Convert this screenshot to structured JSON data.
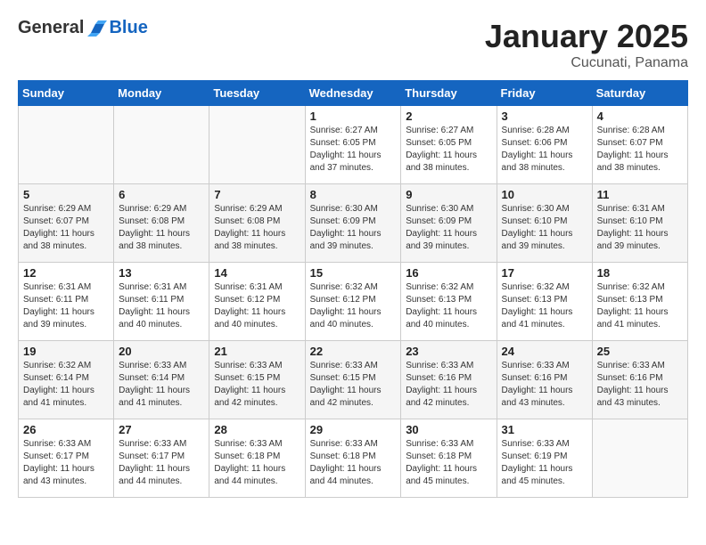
{
  "logo": {
    "general": "General",
    "blue": "Blue"
  },
  "title": "January 2025",
  "subtitle": "Cucunati, Panama",
  "days_of_week": [
    "Sunday",
    "Monday",
    "Tuesday",
    "Wednesday",
    "Thursday",
    "Friday",
    "Saturday"
  ],
  "weeks": [
    [
      {
        "day": "",
        "info": ""
      },
      {
        "day": "",
        "info": ""
      },
      {
        "day": "",
        "info": ""
      },
      {
        "day": "1",
        "info": "Sunrise: 6:27 AM\nSunset: 6:05 PM\nDaylight: 11 hours\nand 37 minutes."
      },
      {
        "day": "2",
        "info": "Sunrise: 6:27 AM\nSunset: 6:05 PM\nDaylight: 11 hours\nand 38 minutes."
      },
      {
        "day": "3",
        "info": "Sunrise: 6:28 AM\nSunset: 6:06 PM\nDaylight: 11 hours\nand 38 minutes."
      },
      {
        "day": "4",
        "info": "Sunrise: 6:28 AM\nSunset: 6:07 PM\nDaylight: 11 hours\nand 38 minutes."
      }
    ],
    [
      {
        "day": "5",
        "info": "Sunrise: 6:29 AM\nSunset: 6:07 PM\nDaylight: 11 hours\nand 38 minutes."
      },
      {
        "day": "6",
        "info": "Sunrise: 6:29 AM\nSunset: 6:08 PM\nDaylight: 11 hours\nand 38 minutes."
      },
      {
        "day": "7",
        "info": "Sunrise: 6:29 AM\nSunset: 6:08 PM\nDaylight: 11 hours\nand 38 minutes."
      },
      {
        "day": "8",
        "info": "Sunrise: 6:30 AM\nSunset: 6:09 PM\nDaylight: 11 hours\nand 39 minutes."
      },
      {
        "day": "9",
        "info": "Sunrise: 6:30 AM\nSunset: 6:09 PM\nDaylight: 11 hours\nand 39 minutes."
      },
      {
        "day": "10",
        "info": "Sunrise: 6:30 AM\nSunset: 6:10 PM\nDaylight: 11 hours\nand 39 minutes."
      },
      {
        "day": "11",
        "info": "Sunrise: 6:31 AM\nSunset: 6:10 PM\nDaylight: 11 hours\nand 39 minutes."
      }
    ],
    [
      {
        "day": "12",
        "info": "Sunrise: 6:31 AM\nSunset: 6:11 PM\nDaylight: 11 hours\nand 39 minutes."
      },
      {
        "day": "13",
        "info": "Sunrise: 6:31 AM\nSunset: 6:11 PM\nDaylight: 11 hours\nand 40 minutes."
      },
      {
        "day": "14",
        "info": "Sunrise: 6:31 AM\nSunset: 6:12 PM\nDaylight: 11 hours\nand 40 minutes."
      },
      {
        "day": "15",
        "info": "Sunrise: 6:32 AM\nSunset: 6:12 PM\nDaylight: 11 hours\nand 40 minutes."
      },
      {
        "day": "16",
        "info": "Sunrise: 6:32 AM\nSunset: 6:13 PM\nDaylight: 11 hours\nand 40 minutes."
      },
      {
        "day": "17",
        "info": "Sunrise: 6:32 AM\nSunset: 6:13 PM\nDaylight: 11 hours\nand 41 minutes."
      },
      {
        "day": "18",
        "info": "Sunrise: 6:32 AM\nSunset: 6:13 PM\nDaylight: 11 hours\nand 41 minutes."
      }
    ],
    [
      {
        "day": "19",
        "info": "Sunrise: 6:32 AM\nSunset: 6:14 PM\nDaylight: 11 hours\nand 41 minutes."
      },
      {
        "day": "20",
        "info": "Sunrise: 6:33 AM\nSunset: 6:14 PM\nDaylight: 11 hours\nand 41 minutes."
      },
      {
        "day": "21",
        "info": "Sunrise: 6:33 AM\nSunset: 6:15 PM\nDaylight: 11 hours\nand 42 minutes."
      },
      {
        "day": "22",
        "info": "Sunrise: 6:33 AM\nSunset: 6:15 PM\nDaylight: 11 hours\nand 42 minutes."
      },
      {
        "day": "23",
        "info": "Sunrise: 6:33 AM\nSunset: 6:16 PM\nDaylight: 11 hours\nand 42 minutes."
      },
      {
        "day": "24",
        "info": "Sunrise: 6:33 AM\nSunset: 6:16 PM\nDaylight: 11 hours\nand 43 minutes."
      },
      {
        "day": "25",
        "info": "Sunrise: 6:33 AM\nSunset: 6:16 PM\nDaylight: 11 hours\nand 43 minutes."
      }
    ],
    [
      {
        "day": "26",
        "info": "Sunrise: 6:33 AM\nSunset: 6:17 PM\nDaylight: 11 hours\nand 43 minutes."
      },
      {
        "day": "27",
        "info": "Sunrise: 6:33 AM\nSunset: 6:17 PM\nDaylight: 11 hours\nand 44 minutes."
      },
      {
        "day": "28",
        "info": "Sunrise: 6:33 AM\nSunset: 6:18 PM\nDaylight: 11 hours\nand 44 minutes."
      },
      {
        "day": "29",
        "info": "Sunrise: 6:33 AM\nSunset: 6:18 PM\nDaylight: 11 hours\nand 44 minutes."
      },
      {
        "day": "30",
        "info": "Sunrise: 6:33 AM\nSunset: 6:18 PM\nDaylight: 11 hours\nand 45 minutes."
      },
      {
        "day": "31",
        "info": "Sunrise: 6:33 AM\nSunset: 6:19 PM\nDaylight: 11 hours\nand 45 minutes."
      },
      {
        "day": "",
        "info": ""
      }
    ]
  ]
}
